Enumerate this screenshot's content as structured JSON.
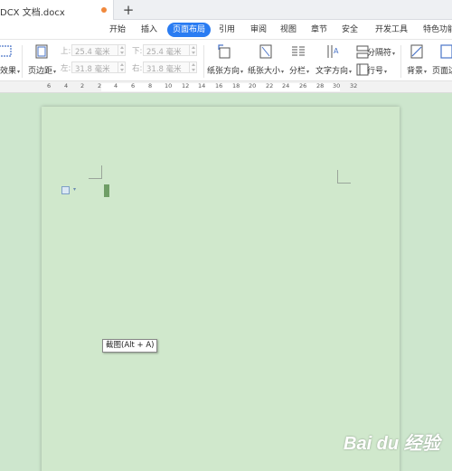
{
  "tabbar": {
    "doc_title": "DCX 文档.docx",
    "new_tab_label": "+"
  },
  "menu": {
    "items": [
      "开始",
      "插入",
      "页面布局",
      "引用",
      "审阅",
      "视图",
      "章节",
      "安全",
      "开发工具",
      "特色功能"
    ],
    "active": "页面布局"
  },
  "ribbon": {
    "effects_label": "效果",
    "margins_label": "页边距",
    "margin_top_label": "上:",
    "margin_top_value": "25.4 毫米",
    "margin_bottom_label": "下:",
    "margin_bottom_value": "25.4 毫米",
    "margin_left_label": "左:",
    "margin_left_value": "31.8 毫米",
    "margin_right_label": "右:",
    "margin_right_value": "31.8 毫米",
    "orientation_label": "纸张方向",
    "size_label": "纸张大小",
    "columns_label": "分栏",
    "text_direction_label": "文字方向",
    "breaks_label": "分隔符",
    "line_numbers_label": "行号",
    "background_label": "背景",
    "page_border_label": "页面边"
  },
  "ruler": {
    "marks": [
      "6",
      "4",
      "2",
      "2",
      "4",
      "6",
      "8",
      "10",
      "12",
      "14",
      "16",
      "18",
      "20",
      "22",
      "24",
      "26",
      "28",
      "30",
      "32"
    ]
  },
  "document": {
    "tooltip": "截图(Alt + A)"
  },
  "watermark": {
    "text": "Bai du 经验"
  },
  "colors": {
    "accent": "#2a7cf2",
    "workspace_bg": "#cde6cd",
    "page_bg": "#d0e8cc"
  }
}
